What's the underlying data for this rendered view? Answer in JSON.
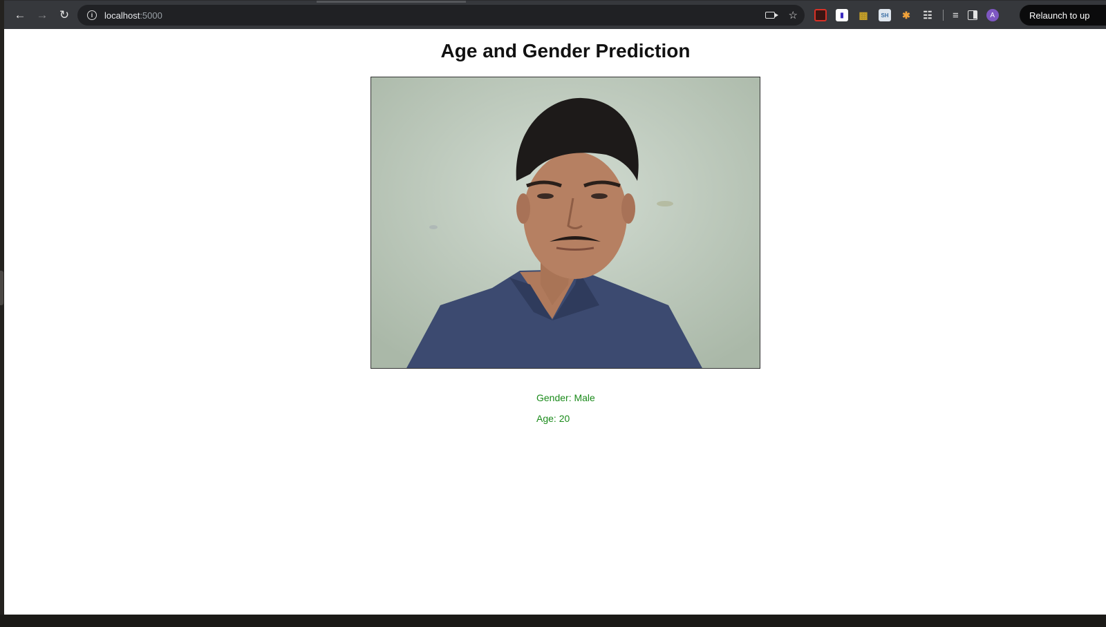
{
  "browser": {
    "url_host": "localhost",
    "url_port": ":5000",
    "relaunch_label": "Relaunch to up",
    "profile_initial": "A",
    "extensions": [
      "record-extension",
      "bitwarden-extension",
      "chart-extension",
      "sh-extension",
      "color-extension",
      "extensions-puzzle"
    ]
  },
  "page": {
    "title": "Age and Gender Prediction",
    "gender_text": "Gender: Male",
    "age_text": "Age: 20"
  },
  "colors": {
    "result_text": "#1a8a1a",
    "toolbar": "#36383c",
    "omnibox": "#202124"
  }
}
